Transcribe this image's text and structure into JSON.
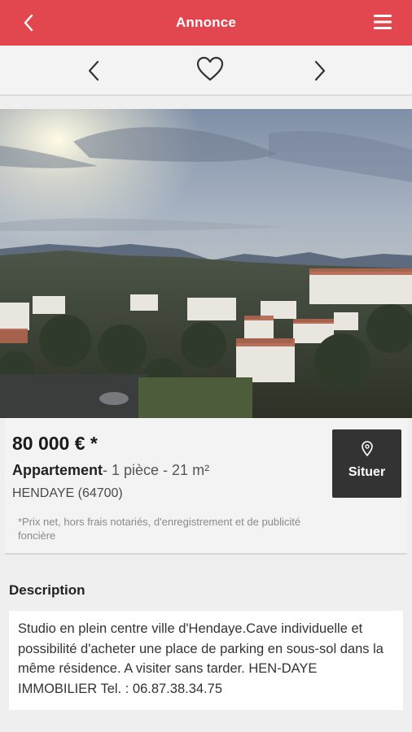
{
  "header": {
    "title": "Annonce",
    "color": "#e2474f"
  },
  "nav": {
    "prev_icon": "chevron-left-icon",
    "favorite_icon": "heart-outline-icon",
    "next_icon": "chevron-right-icon"
  },
  "listing": {
    "price": "80 000 € *",
    "type": "Appartement",
    "details": "- 1 pièce - 21 m²",
    "city": "HENDAYE (64700)",
    "price_note": "*Prix net, hors frais notariés, d'enregistrement et de publicité foncière",
    "locate_label": "Situer"
  },
  "description": {
    "title": "Description",
    "text": "Studio en plein centre ville d'Hendaye.Cave individuelle et possibilité d'acheter une place de parking en sous-sol dans la même résidence. A visiter sans tarder. HEN-DAYE IMMOBILIER Tel. : 06.87.38.34.75"
  }
}
